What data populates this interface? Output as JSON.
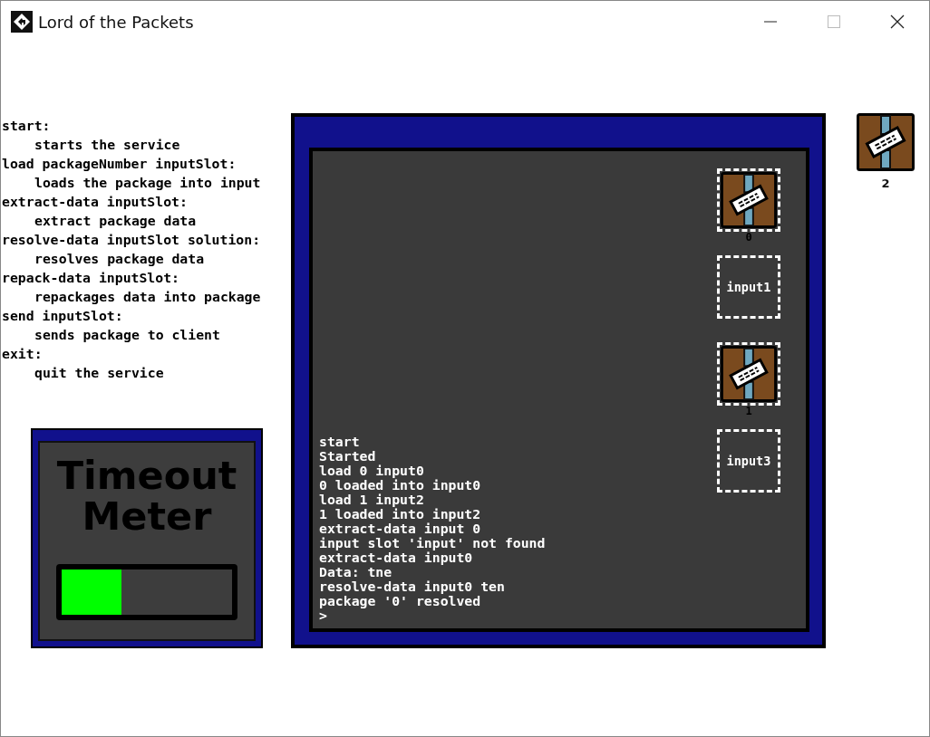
{
  "window": {
    "title": "Lord of the Packets"
  },
  "help": [
    {
      "command": "start:",
      "description": "starts the service"
    },
    {
      "command": "load packageNumber inputSlot:",
      "description": "loads the package into input"
    },
    {
      "command": "extract-data inputSlot:",
      "description": "extract package data"
    },
    {
      "command": "resolve-data inputSlot solution:",
      "description": "resolves package data"
    },
    {
      "command": "repack-data inputSlot:",
      "description": "repackages data into package"
    },
    {
      "command": "send inputSlot:",
      "description": "sends package to client"
    },
    {
      "command": "exit:",
      "description": "quit the service"
    }
  ],
  "timeout_meter": {
    "title": "Timeout Meter",
    "level": 0.35
  },
  "console": {
    "lines": [
      "start",
      "Started",
      "load 0 input0",
      "0 loaded into input0",
      "load 1 input2",
      "1 loaded into input2",
      "extract-data input 0",
      "input slot 'input' not found",
      "extract-data input0",
      "Data: tne",
      "resolve-data input0 ten",
      "package '0' resolved"
    ],
    "prompt": ">"
  },
  "slots": [
    {
      "kind": "package",
      "label": "0"
    },
    {
      "kind": "empty",
      "label": "input1"
    },
    {
      "kind": "package",
      "label": "1"
    },
    {
      "kind": "empty",
      "label": "input3"
    }
  ],
  "loose_package": {
    "label": "2"
  }
}
